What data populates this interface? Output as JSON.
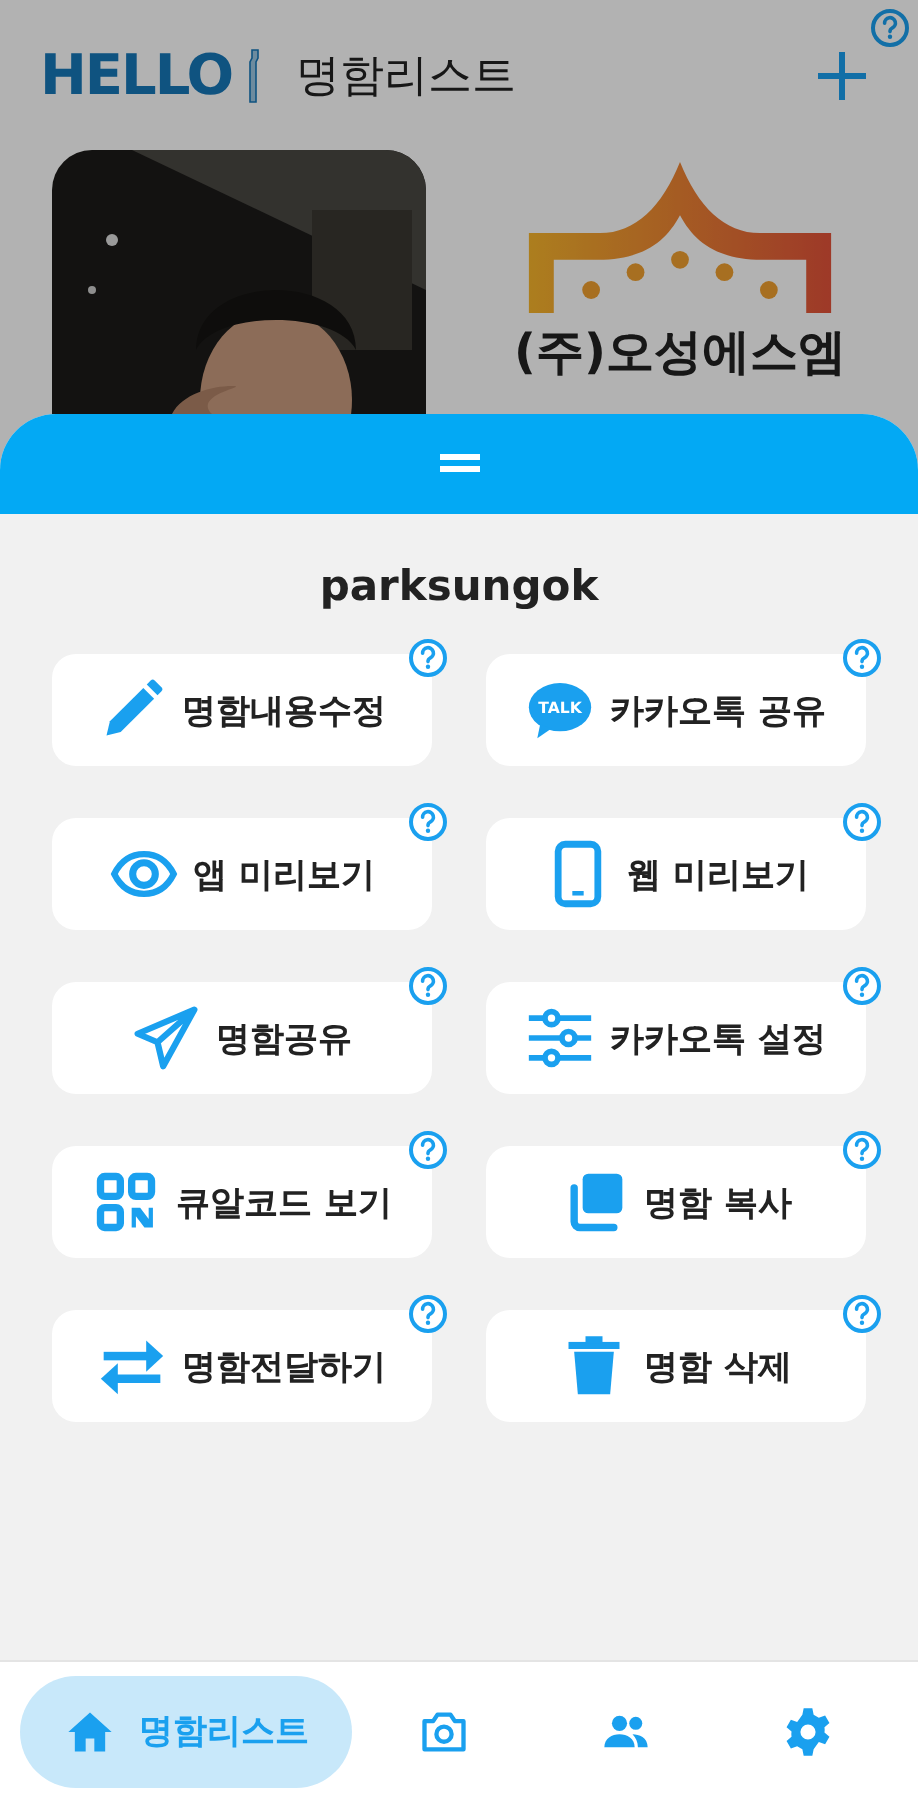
{
  "header": {
    "logo": "HELLO",
    "title": "명함리스트"
  },
  "cards": [
    {
      "kind": "picture"
    },
    {
      "kind": "logo",
      "company": "(주)오성에스엠"
    }
  ],
  "sheet": {
    "title": "parksungok",
    "actions": [
      {
        "kind": "pencil",
        "label": "명함내용수정"
      },
      {
        "kind": "talk",
        "label": "카카오톡 공유",
        "badge": "TALK"
      },
      {
        "kind": "eye",
        "label": "앱 미리보기"
      },
      {
        "kind": "phone",
        "label": "웹 미리보기"
      },
      {
        "kind": "plane",
        "label": "명함공유"
      },
      {
        "kind": "sliders",
        "label": "카카오톡 설정"
      },
      {
        "kind": "qr",
        "label": "큐알코드 보기"
      },
      {
        "kind": "copy",
        "label": "명함 복사"
      },
      {
        "kind": "swap",
        "label": "명함전달하기"
      },
      {
        "kind": "trash",
        "label": "명함 삭제"
      }
    ]
  },
  "nav": [
    {
      "kind": "home",
      "label": "명함리스트",
      "selected": true
    },
    {
      "kind": "camera",
      "selected": false
    },
    {
      "kind": "people",
      "selected": false
    },
    {
      "kind": "gear",
      "selected": false
    }
  ]
}
